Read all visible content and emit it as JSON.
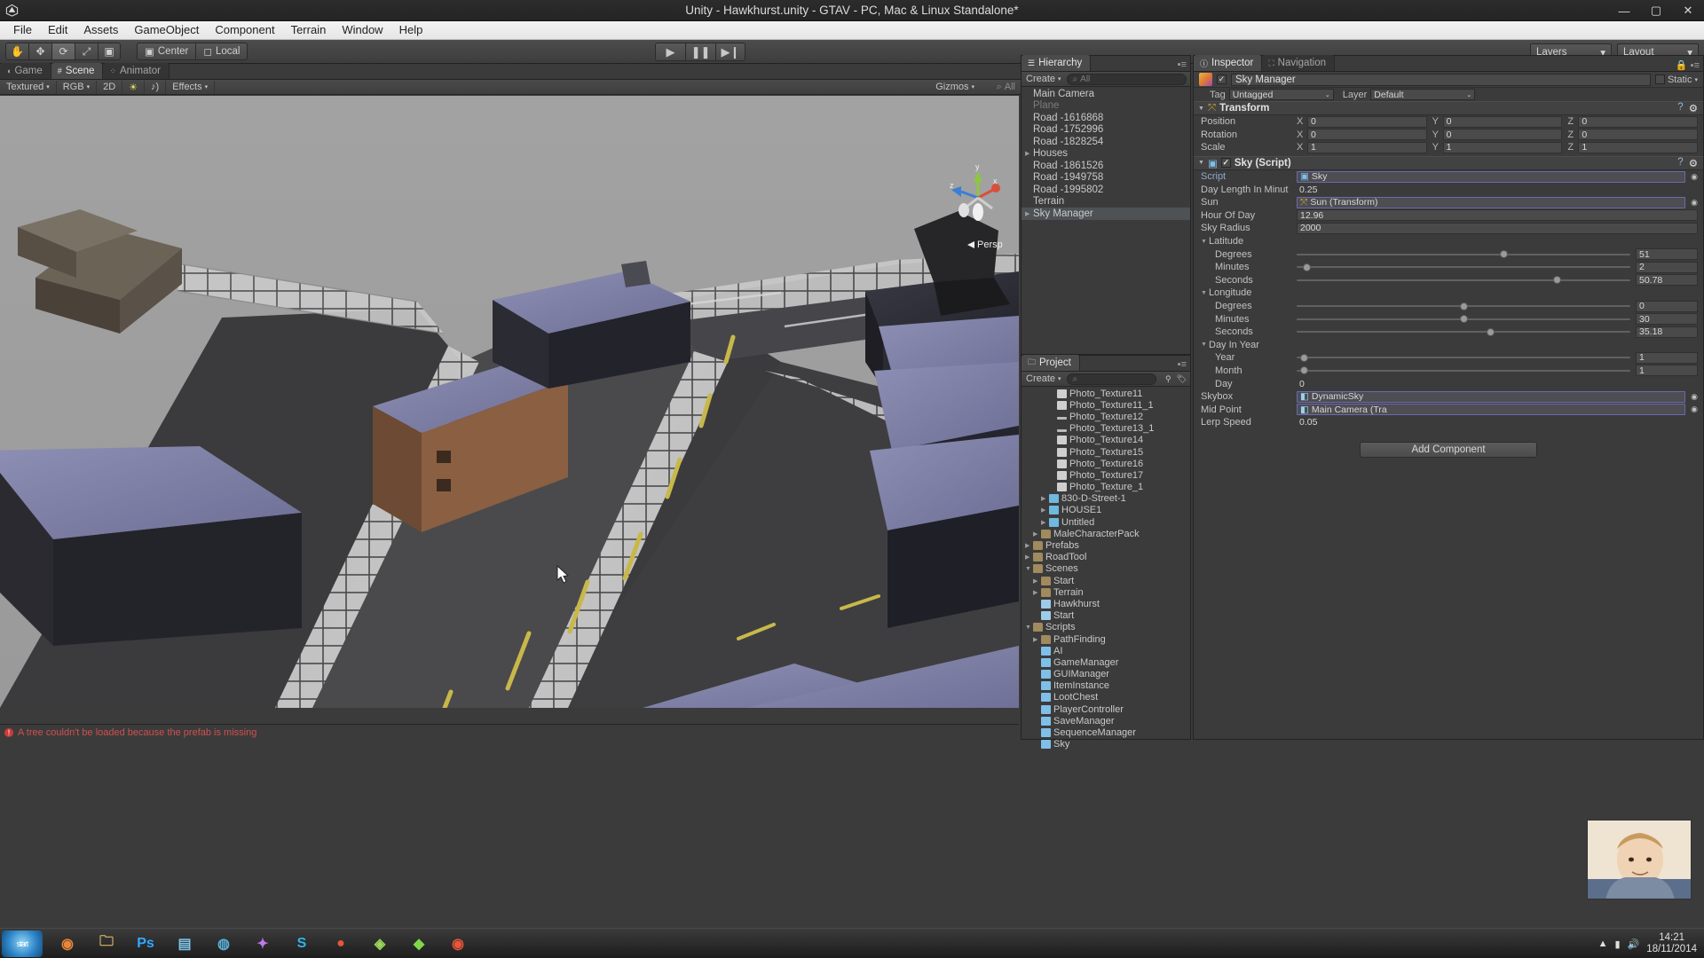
{
  "window": {
    "title": "Unity - Hawkhurst.unity - GTAV - PC, Mac & Linux Standalone*",
    "minimize": "—",
    "maximize": "▢",
    "close": "✕"
  },
  "menubar": {
    "items": [
      "File",
      "Edit",
      "Assets",
      "GameObject",
      "Component",
      "Terrain",
      "Window",
      "Help"
    ]
  },
  "toolbar": {
    "transform_tools": [
      {
        "name": "hand-tool",
        "glyph": "✋",
        "active": false
      },
      {
        "name": "move-tool",
        "glyph": "✥",
        "active": false
      },
      {
        "name": "rotate-tool",
        "glyph": "⟳",
        "active": true
      },
      {
        "name": "scale-tool",
        "glyph": "⤢",
        "active": false
      },
      {
        "name": "rect-tool",
        "glyph": "▣",
        "active": false
      }
    ],
    "pivot_label": "Center",
    "space_label": "Local",
    "play": "▶",
    "pause": "❚❚",
    "step": "▶❙",
    "layers_label": "Layers",
    "layout_label": "Layout"
  },
  "scene": {
    "tabs": [
      {
        "label": "Game",
        "icon": "game-icon",
        "active": false
      },
      {
        "label": "Scene",
        "icon": "scene-icon",
        "active": true
      },
      {
        "label": "Animator",
        "icon": "animator-icon",
        "active": false
      }
    ],
    "toolbar": {
      "draw_mode": "Textured",
      "render_mode": "RGB",
      "mode_2d": "2D",
      "lighting_icon": "light-icon",
      "audio_icon": "audio-icon",
      "effects": "Effects",
      "gizmos": "Gizmos",
      "search_placeholder": "All"
    },
    "gizmo": {
      "axis_x": "x",
      "axis_y": "y",
      "axis_z": "z",
      "projection": "Persp"
    },
    "status": "A tree couldn't be loaded because the prefab is missing"
  },
  "hierarchy": {
    "tab_label": "Hierarchy",
    "create_label": "Create",
    "search_placeholder": "All",
    "items": [
      {
        "label": "Main Camera",
        "expandable": false,
        "selected": false,
        "dim": false
      },
      {
        "label": "Plane",
        "expandable": false,
        "selected": false,
        "dim": true
      },
      {
        "label": "Road -1616868",
        "expandable": false,
        "selected": false,
        "dim": false
      },
      {
        "label": "Road -1752996",
        "expandable": false,
        "selected": false,
        "dim": false
      },
      {
        "label": "Road -1828254",
        "expandable": false,
        "selected": false,
        "dim": false
      },
      {
        "label": "Houses",
        "expandable": true,
        "selected": false,
        "dim": false
      },
      {
        "label": "Road -1861526",
        "expandable": false,
        "selected": false,
        "dim": false
      },
      {
        "label": "Road -1949758",
        "expandable": false,
        "selected": false,
        "dim": false
      },
      {
        "label": "Road -1995802",
        "expandable": false,
        "selected": false,
        "dim": false
      },
      {
        "label": "Terrain",
        "expandable": false,
        "selected": false,
        "dim": false
      },
      {
        "label": "Sky Manager",
        "expandable": true,
        "selected": true,
        "dim": false
      }
    ]
  },
  "project": {
    "tab_label": "Project",
    "create_label": "Create",
    "items": [
      {
        "label": "Photo_Texture11",
        "indent": 3,
        "icon": "tex",
        "arrow": false
      },
      {
        "label": "Photo_Texture11_1",
        "indent": 3,
        "icon": "tex",
        "arrow": false
      },
      {
        "label": "Photo_Texture12",
        "indent": 3,
        "icon": "line",
        "arrow": false
      },
      {
        "label": "Photo_Texture13_1",
        "indent": 3,
        "icon": "line",
        "arrow": false
      },
      {
        "label": "Photo_Texture14",
        "indent": 3,
        "icon": "tex",
        "arrow": false
      },
      {
        "label": "Photo_Texture15",
        "indent": 3,
        "icon": "tex",
        "arrow": false
      },
      {
        "label": "Photo_Texture16",
        "indent": 3,
        "icon": "tex",
        "arrow": false
      },
      {
        "label": "Photo_Texture17",
        "indent": 3,
        "icon": "tex",
        "arrow": false
      },
      {
        "label": "Photo_Texture_1",
        "indent": 3,
        "icon": "tex",
        "arrow": false
      },
      {
        "label": "830-D-Street-1",
        "indent": 2,
        "icon": "mesh",
        "arrow": true
      },
      {
        "label": "HOUSE1",
        "indent": 2,
        "icon": "mesh",
        "arrow": true
      },
      {
        "label": "Untitled",
        "indent": 2,
        "icon": "mesh",
        "arrow": true
      },
      {
        "label": "MaleCharacterPack",
        "indent": 1,
        "icon": "folder",
        "arrow": true
      },
      {
        "label": "Prefabs",
        "indent": 0,
        "icon": "folder",
        "arrow": true
      },
      {
        "label": "RoadTool",
        "indent": 0,
        "icon": "folder",
        "arrow": true
      },
      {
        "label": "Scenes",
        "indent": 0,
        "icon": "folder",
        "arrow": true,
        "open": true
      },
      {
        "label": "Start",
        "indent": 1,
        "icon": "folder",
        "arrow": true
      },
      {
        "label": "Terrain",
        "indent": 1,
        "icon": "folder",
        "arrow": true
      },
      {
        "label": "Hawkhurst",
        "indent": 1,
        "icon": "scene",
        "arrow": false
      },
      {
        "label": "Start",
        "indent": 1,
        "icon": "scene",
        "arrow": false
      },
      {
        "label": "Scripts",
        "indent": 0,
        "icon": "folder",
        "arrow": true,
        "open": true
      },
      {
        "label": "PathFinding",
        "indent": 1,
        "icon": "folder",
        "arrow": true
      },
      {
        "label": "AI",
        "indent": 1,
        "icon": "script",
        "arrow": false
      },
      {
        "label": "GameManager",
        "indent": 1,
        "icon": "script",
        "arrow": false
      },
      {
        "label": "GUIManager",
        "indent": 1,
        "icon": "script",
        "arrow": false
      },
      {
        "label": "ItemInstance",
        "indent": 1,
        "icon": "script",
        "arrow": false
      },
      {
        "label": "LootChest",
        "indent": 1,
        "icon": "script",
        "arrow": false
      },
      {
        "label": "PlayerController",
        "indent": 1,
        "icon": "script",
        "arrow": false
      },
      {
        "label": "SaveManager",
        "indent": 1,
        "icon": "script",
        "arrow": false
      },
      {
        "label": "SequenceManager",
        "indent": 1,
        "icon": "script",
        "arrow": false
      },
      {
        "label": "Sky",
        "indent": 1,
        "icon": "script",
        "arrow": false
      }
    ]
  },
  "inspector": {
    "tabs": [
      {
        "label": "Inspector",
        "icon": "info-icon",
        "active": true
      },
      {
        "label": "Navigation",
        "icon": "navigation-icon",
        "active": false
      }
    ],
    "gameobject": {
      "name": "Sky Manager",
      "enabled": true,
      "static_label": "Static",
      "tag_label": "Tag",
      "tag_value": "Untagged",
      "layer_label": "Layer",
      "layer_value": "Default"
    },
    "transform": {
      "title": "Transform",
      "rows": [
        {
          "label": "Position",
          "x": "0",
          "y": "0",
          "z": "0"
        },
        {
          "label": "Rotation",
          "x": "0",
          "y": "0",
          "z": "0"
        },
        {
          "label": "Scale",
          "x": "1",
          "y": "1",
          "z": "1"
        }
      ]
    },
    "sky_script": {
      "title": "Sky (Script)",
      "enabled": true,
      "script_label": "Script",
      "script_value": "Sky",
      "fields": [
        {
          "label": "Day Length In Minut",
          "value": "0.25",
          "type": "flat"
        },
        {
          "label": "Sun",
          "value": "Sun (Transform)",
          "type": "object"
        },
        {
          "label": "Hour Of Day",
          "value": "12.96",
          "type": "text"
        },
        {
          "label": "Sky Radius",
          "value": "2000",
          "type": "text"
        }
      ],
      "groups": [
        {
          "title": "Latitude",
          "rows": [
            {
              "label": "Degrees",
              "value": "51",
              "pct": 62
            },
            {
              "label": "Minutes",
              "value": "2",
              "pct": 3
            },
            {
              "label": "Seconds",
              "value": "50.78",
              "pct": 78
            }
          ]
        },
        {
          "title": "Longitude",
          "rows": [
            {
              "label": "Degrees",
              "value": "0",
              "pct": 50
            },
            {
              "label": "Minutes",
              "value": "30",
              "pct": 50
            },
            {
              "label": "Seconds",
              "value": "35.18",
              "pct": 58
            }
          ]
        },
        {
          "title": "Day In Year",
          "rows": [
            {
              "label": "Year",
              "value": "1",
              "pct": 2
            },
            {
              "label": "Month",
              "value": "1",
              "pct": 2
            },
            {
              "label": "Day",
              "value": "0",
              "pct": 0,
              "noslider": true
            }
          ]
        }
      ],
      "tail_fields": [
        {
          "label": "Skybox",
          "value": "DynamicSky",
          "type": "object"
        },
        {
          "label": "Mid Point",
          "value": "Main Camera (Tra",
          "type": "object"
        },
        {
          "label": "Lerp Speed",
          "value": "0.05",
          "type": "flat"
        }
      ]
    },
    "add_component_label": "Add Component"
  },
  "taskbar": {
    "start_label": "start",
    "icons": [
      {
        "name": "taskbar-icon-firefox",
        "glyph": "◉",
        "color": "#e8863a"
      },
      {
        "name": "taskbar-icon-folder",
        "glyph": "🗀",
        "color": "#e8c46a"
      },
      {
        "name": "taskbar-icon-photoshop",
        "glyph": "Ps",
        "color": "#31a8ff"
      },
      {
        "name": "taskbar-icon-explorer",
        "glyph": "▤",
        "color": "#7fc3e8"
      },
      {
        "name": "taskbar-icon-media",
        "glyph": "◍",
        "color": "#5ab0d8"
      },
      {
        "name": "taskbar-icon-sparkle",
        "glyph": "✦",
        "color": "#c27ae8"
      },
      {
        "name": "taskbar-icon-skype",
        "glyph": "S",
        "color": "#2fb3e8"
      },
      {
        "name": "taskbar-icon-record",
        "glyph": "●",
        "color": "#e8553a"
      },
      {
        "name": "taskbar-icon-unity-1",
        "glyph": "◈",
        "color": "#9ad85a"
      },
      {
        "name": "taskbar-icon-unity-2",
        "glyph": "◆",
        "color": "#7fd84a"
      },
      {
        "name": "taskbar-icon-record-2",
        "glyph": "◉",
        "color": "#e8553a"
      }
    ],
    "clock_time": "14:21",
    "clock_date": "18/11/2014",
    "tray_up": "▲",
    "tray_network": "▮",
    "tray_volume": "🔊"
  }
}
